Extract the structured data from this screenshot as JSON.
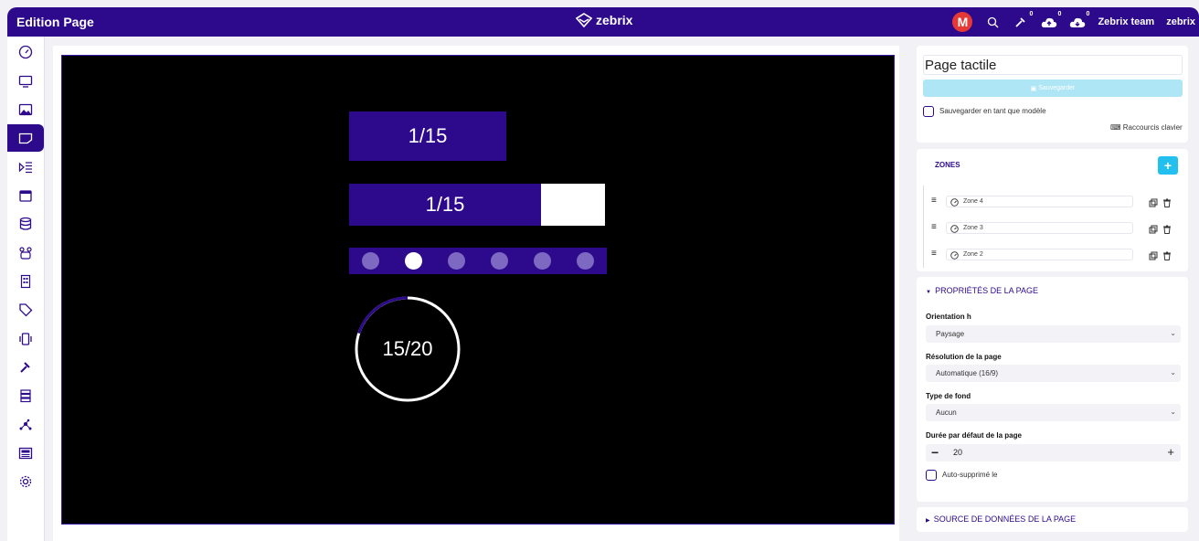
{
  "topbar": {
    "title": "Edition Page",
    "brand": "zebrix",
    "avatar_letter": "M",
    "badge1": "0",
    "badge2": "0",
    "badge3": "0",
    "team_label": "Zebrix team",
    "user_label": "zebrix",
    "brand_color": "#2d0a8c",
    "avatar_color": "#e53935"
  },
  "sidebar": {
    "items": [
      {
        "icon": "dashboard-icon"
      },
      {
        "icon": "monitor-icon"
      },
      {
        "icon": "image-icon"
      },
      {
        "icon": "page-icon",
        "active": true
      },
      {
        "icon": "playlist-icon"
      },
      {
        "icon": "calendar-icon"
      },
      {
        "icon": "database-icon"
      },
      {
        "icon": "group-icon"
      },
      {
        "icon": "building-icon"
      },
      {
        "icon": "tag-icon"
      },
      {
        "icon": "device-icon"
      },
      {
        "icon": "tools-icon"
      },
      {
        "icon": "server-icon"
      },
      {
        "icon": "network-icon"
      },
      {
        "icon": "news-icon"
      },
      {
        "icon": "settings-icon"
      }
    ]
  },
  "canvas": {
    "counter_text": "1/15",
    "progress_text": "1/15",
    "progress_value": 0.75,
    "dots_total": 6,
    "dots_active": 2,
    "ring_text": "15/20",
    "ring_fraction": 0.2
  },
  "page_panel": {
    "name": "Page tactile",
    "save_label": "Sauvegarder",
    "template_label": "Sauvegarder en tant que modèle",
    "shortcuts_label": "Raccourcis clavier"
  },
  "zones": {
    "title": "ZONES",
    "add_label": "+",
    "items": [
      "Zone 4",
      "Zone 3",
      "Zone 2"
    ]
  },
  "properties": {
    "title": "PROPRIÉTÉS DE LA PAGE",
    "orientation_label": "Orientation h",
    "orientation_value": "Paysage",
    "resolution_label": "Résolution de la page",
    "resolution_value": "Automatique (16/9)",
    "background_label": "Type de fond",
    "background_value": "Aucun",
    "duration_label": "Durée par défaut de la page",
    "duration_value": "20",
    "autodelete_label": "Auto-supprimé le"
  },
  "datasource": {
    "title": "SOURCE DE DONNÉES DE LA PAGE"
  }
}
